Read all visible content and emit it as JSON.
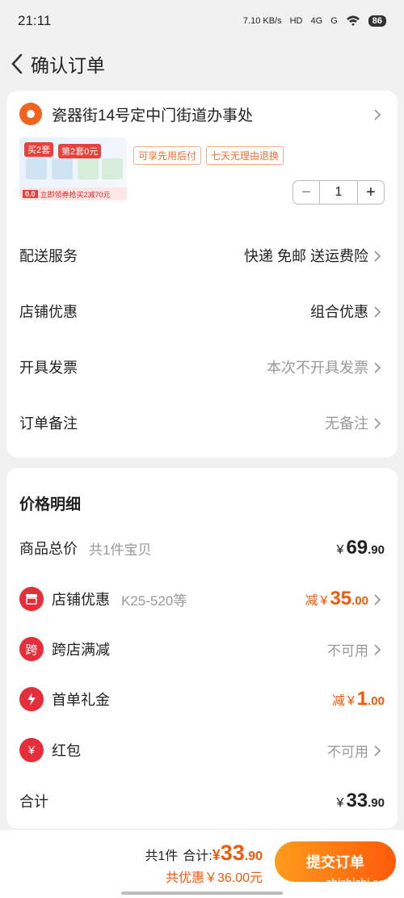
{
  "status": {
    "time": "21:11",
    "net_speed": "7.10 KB/s",
    "hd": "HD",
    "sig1": "4G",
    "sig2": "G",
    "battery": "86"
  },
  "nav": {
    "title": "确认订单"
  },
  "address": {
    "text": "瓷器街14号定中门街道办事处"
  },
  "product": {
    "img_tag1": "买2套",
    "img_tag2": "第2套0元",
    "img_bottom_price": "0.0",
    "img_bottom_text": "立即领券抢买2减70元",
    "tags": [
      "可享先用后付",
      "七天无理由退换"
    ],
    "quantity": "1",
    "minus": "−",
    "plus": "+"
  },
  "order_rows": [
    {
      "label": "配送服务",
      "value": "快递 免邮 送运费险",
      "gray": false
    },
    {
      "label": "店铺优惠",
      "value": "组合优惠",
      "gray": false
    },
    {
      "label": "开具发票",
      "value": "本次不开具发票",
      "gray": true
    },
    {
      "label": "订单备注",
      "value": "无备注",
      "gray": true
    }
  ],
  "price": {
    "title": "价格明细",
    "goods_total": {
      "label": "商品总价",
      "sub": "共1件宝贝",
      "yen": "¥",
      "int": "69",
      "dec": ".90"
    },
    "shop_discount": {
      "label": "店铺优惠",
      "sub": "K25-520等",
      "cut": "减",
      "yen": "¥",
      "int": "35",
      "dec": ".00"
    },
    "cross_store": {
      "label": "跨店满减",
      "icon_text": "跨",
      "value": "不可用"
    },
    "first_order": {
      "label": "首单礼金",
      "cut": "减",
      "yen": "¥",
      "int": "1",
      "dec": ".00"
    },
    "red_packet": {
      "label": "红包",
      "icon_text": "¥",
      "value": "不可用"
    },
    "total": {
      "label": "合计",
      "yen": "¥",
      "int": "33",
      "dec": ".90"
    }
  },
  "bottom": {
    "count": "共1件",
    "total_label": "合计:",
    "yen": "¥",
    "int": "33",
    "dec": ".90",
    "save": "共优惠￥36.00元",
    "submit": "提交订单",
    "watermark": "zhizhizhi.com"
  },
  "colors": {
    "accent": "#f05a0a",
    "red": "#e62e3a"
  }
}
